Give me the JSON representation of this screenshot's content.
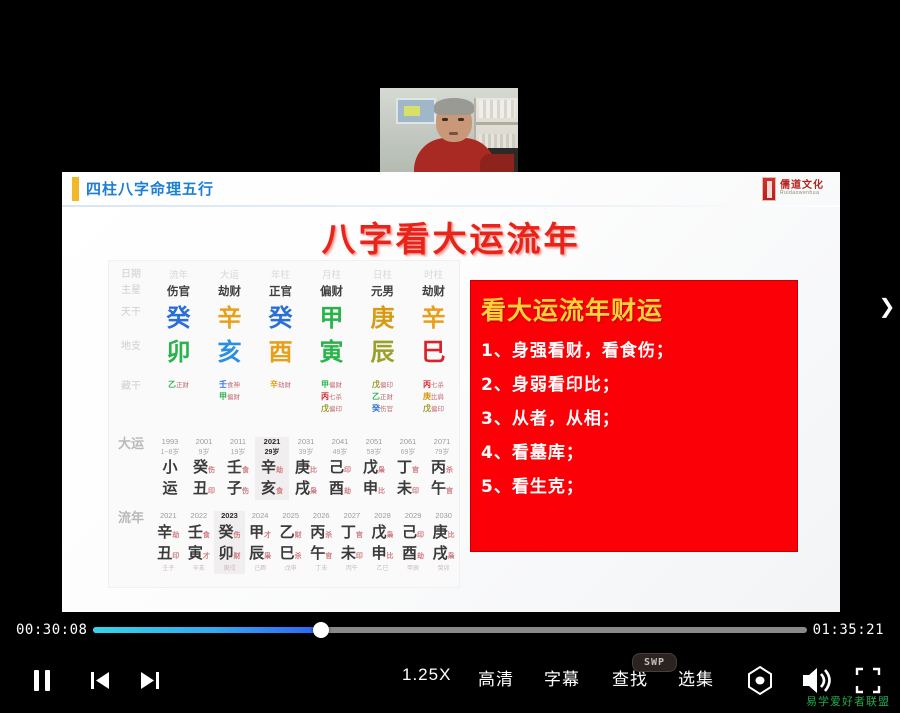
{
  "player": {
    "current_time": "00:30:08",
    "total_time": "01:35:21",
    "progress_percent": 32,
    "accent_start": "#34d6e8",
    "accent_end": "#2e63f5",
    "track_color": "#8a8a8a",
    "buttons": {
      "pause": "pause-icon",
      "prev": "previous-episode-icon",
      "next": "next-episode-icon",
      "speed": "1.25X",
      "quality": "高清",
      "subtitle": "字幕",
      "find": "查找",
      "episodes": "选集",
      "target": "focus-icon",
      "volume": "volume-icon",
      "fullscreen": "fullscreen-icon"
    },
    "swp_badge": "SWP",
    "watermark": "易学爱好者联盟",
    "next_slide_arrow": "❯"
  },
  "slide": {
    "header": "四柱八字命理五行",
    "header_color": "#1c7fd4",
    "accent_bar_color": "#f2b827",
    "title": "八字看大运流年",
    "title_color": "#e8241a",
    "logo": {
      "name": "儒道文化",
      "subtitle": "Ruidaowenhua"
    },
    "red_box": {
      "bg": "#fb0007",
      "heading": "看大运流年财运",
      "heading_color": "#ffd23c",
      "items": [
        "1、身强看财，看食伤；",
        "2、身弱看印比；",
        "3、从者，从相；",
        "4、看墓库；",
        "5、看生克；"
      ]
    },
    "bazi": {
      "row_labels": [
        "日期",
        "主星",
        "天干",
        "地支",
        "藏干"
      ],
      "columns": [
        "流年",
        "大运",
        "年柱",
        "月柱",
        "日柱",
        "时柱"
      ],
      "main_stars": [
        "伤官",
        "劫财",
        "正官",
        "偏财",
        "元男",
        "劫财"
      ],
      "heaven_stems": [
        {
          "char": "癸",
          "color": "#2a6fd8"
        },
        {
          "char": "辛",
          "color": "#e8a01a"
        },
        {
          "char": "癸",
          "color": "#2a6fd8"
        },
        {
          "char": "甲",
          "color": "#28b44a"
        },
        {
          "char": "庚",
          "color": "#d79a10"
        },
        {
          "char": "辛",
          "color": "#e8a01a"
        }
      ],
      "earth_branches": [
        {
          "char": "卯",
          "color": "#28b44a"
        },
        {
          "char": "亥",
          "color": "#2a8fe0"
        },
        {
          "char": "酉",
          "color": "#e8a01a"
        },
        {
          "char": "寅",
          "color": "#28b44a"
        },
        {
          "char": "辰",
          "color": "#9aa02a"
        },
        {
          "char": "巳",
          "color": "#d8232a"
        }
      ],
      "hidden_stems": [
        [
          {
            "s": "乙",
            "c": "#28b44a",
            "g": "正财"
          }
        ],
        [
          {
            "s": "壬",
            "c": "#2a6fd8",
            "g": "食神"
          },
          {
            "s": "甲",
            "c": "#28b44a",
            "g": "偏财"
          }
        ],
        [
          {
            "s": "辛",
            "c": "#e8a01a",
            "g": "劫财"
          }
        ],
        [
          {
            "s": "甲",
            "c": "#28b44a",
            "g": "偏财"
          },
          {
            "s": "丙",
            "c": "#d8232a",
            "g": "七杀"
          },
          {
            "s": "戊",
            "c": "#9aa02a",
            "g": "偏印"
          }
        ],
        [
          {
            "s": "戊",
            "c": "#9aa02a",
            "g": "偏印"
          },
          {
            "s": "乙",
            "c": "#28b44a",
            "g": "正财"
          },
          {
            "s": "癸",
            "c": "#2a6fd8",
            "g": "伤官"
          }
        ],
        [
          {
            "s": "丙",
            "c": "#d8232a",
            "g": "七杀"
          },
          {
            "s": "庚",
            "c": "#d79a10",
            "g": "比肩"
          },
          {
            "s": "戊",
            "c": "#9aa02a",
            "g": "偏印"
          }
        ]
      ],
      "luck_label": "大运",
      "luck": [
        {
          "year": "1993",
          "age": "1~8岁",
          "stem": "小",
          "stem_sub": "",
          "branch": "运",
          "branch_sub": "",
          "highlight": false
        },
        {
          "year": "2001",
          "age": "9岁",
          "stem": "癸",
          "stem_sub": "伤",
          "branch": "丑",
          "branch_sub": "印",
          "highlight": false
        },
        {
          "year": "2011",
          "age": "19岁",
          "stem": "壬",
          "stem_sub": "食",
          "branch": "子",
          "branch_sub": "伤",
          "highlight": false
        },
        {
          "year": "2021",
          "age": "29岁",
          "stem": "辛",
          "stem_sub": "劫",
          "branch": "亥",
          "branch_sub": "食",
          "highlight": true
        },
        {
          "year": "2031",
          "age": "39岁",
          "stem": "庚",
          "stem_sub": "比",
          "branch": "戌",
          "branch_sub": "枭",
          "highlight": false
        },
        {
          "year": "2041",
          "age": "49岁",
          "stem": "己",
          "stem_sub": "印",
          "branch": "酉",
          "branch_sub": "劫",
          "highlight": false
        },
        {
          "year": "2051",
          "age": "59岁",
          "stem": "戊",
          "stem_sub": "枭",
          "branch": "申",
          "branch_sub": "比",
          "highlight": false
        },
        {
          "year": "2061",
          "age": "69岁",
          "stem": "丁",
          "stem_sub": "官",
          "branch": "未",
          "branch_sub": "印",
          "highlight": false
        },
        {
          "year": "2071",
          "age": "79岁",
          "stem": "丙",
          "stem_sub": "杀",
          "branch": "午",
          "branch_sub": "官",
          "highlight": false
        }
      ],
      "year_label": "流年",
      "years": [
        {
          "year": "2021",
          "stem": "辛",
          "stem_sub": "劫",
          "branch": "丑",
          "branch_sub": "印",
          "note": "壬子",
          "highlight": false
        },
        {
          "year": "2022",
          "stem": "壬",
          "stem_sub": "食",
          "branch": "寅",
          "branch_sub": "才",
          "note": "辛亥",
          "highlight": false
        },
        {
          "year": "2023",
          "stem": "癸",
          "stem_sub": "伤",
          "branch": "卯",
          "branch_sub": "财",
          "note": "庚戌",
          "highlight": true
        },
        {
          "year": "2024",
          "stem": "甲",
          "stem_sub": "才",
          "branch": "辰",
          "branch_sub": "枭",
          "note": "己酉",
          "highlight": false
        },
        {
          "year": "2025",
          "stem": "乙",
          "stem_sub": "财",
          "branch": "巳",
          "branch_sub": "杀",
          "note": "戊申",
          "highlight": false
        },
        {
          "year": "2026",
          "stem": "丙",
          "stem_sub": "杀",
          "branch": "午",
          "branch_sub": "官",
          "note": "丁未",
          "highlight": false
        },
        {
          "year": "2027",
          "stem": "丁",
          "stem_sub": "官",
          "branch": "未",
          "branch_sub": "印",
          "note": "丙午",
          "highlight": false
        },
        {
          "year": "2028",
          "stem": "戊",
          "stem_sub": "枭",
          "branch": "申",
          "branch_sub": "比",
          "note": "乙巳",
          "highlight": false
        },
        {
          "year": "2029",
          "stem": "己",
          "stem_sub": "印",
          "branch": "酉",
          "branch_sub": "劫",
          "note": "甲辰",
          "highlight": false
        },
        {
          "year": "2030",
          "stem": "庚",
          "stem_sub": "比",
          "branch": "戌",
          "branch_sub": "枭",
          "note": "癸卯",
          "highlight": false
        }
      ]
    }
  }
}
